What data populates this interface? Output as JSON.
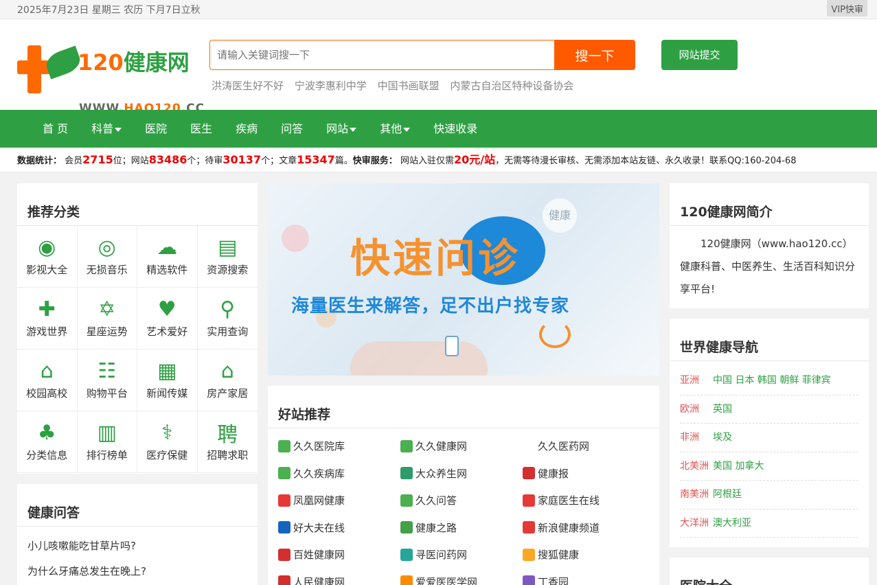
{
  "topbar": {
    "date": "2025年7月23日 星期三 农历 下月7日立秋",
    "vip": "VIP快审"
  },
  "logo": {
    "title_num": "120",
    "title_text": "健康网",
    "url_a": "WWW.",
    "url_b": "HAO120",
    "url_c": ".CC"
  },
  "search": {
    "placeholder": "请输入关键词搜一下",
    "button": "搜一下"
  },
  "submit": "网站提交",
  "hotlinks": [
    "洪涛医生好不好",
    "宁波李惠利中学",
    "中国书画联盟",
    "内蒙古自治区特种设备协会"
  ],
  "nav": [
    {
      "label": "首 页",
      "dropdown": false
    },
    {
      "label": "科普",
      "dropdown": true
    },
    {
      "label": "医院",
      "dropdown": false
    },
    {
      "label": "医生",
      "dropdown": false
    },
    {
      "label": "疾病",
      "dropdown": false
    },
    {
      "label": "问答",
      "dropdown": false
    },
    {
      "label": "网站",
      "dropdown": true
    },
    {
      "label": "其他",
      "dropdown": true
    },
    {
      "label": "快速收录",
      "dropdown": false
    }
  ],
  "stats": {
    "label": "数据统计：",
    "members_pre": "会员",
    "members": "2715",
    "members_suf": "位；网站",
    "sites": "83486",
    "sites_suf": "个；待审",
    "pending": "30137",
    "pending_suf": "个；文章",
    "articles": "15347",
    "articles_suf": "篇。",
    "service_label": "快审服务：",
    "service_pre": "网站入驻仅需",
    "price": "20元/站",
    "service_suf": "，无需等待漫长审核、无需添加本站友链、永久收录！联系QQ:160-204-68"
  },
  "categories": {
    "title": "推荐分类",
    "items": [
      {
        "label": "影视大全",
        "icon": "film-reel-icon"
      },
      {
        "label": "无损音乐",
        "icon": "music-disc-icon"
      },
      {
        "label": "精选软件",
        "icon": "cloud-download-icon"
      },
      {
        "label": "资源搜索",
        "icon": "file-search-icon"
      },
      {
        "label": "游戏世界",
        "icon": "gamepad-icon"
      },
      {
        "label": "星座运势",
        "icon": "star-of-david-icon"
      },
      {
        "label": "艺术爱好",
        "icon": "heart-badge-icon"
      },
      {
        "label": "实用查询",
        "icon": "hand-search-icon"
      },
      {
        "label": "校园高校",
        "icon": "building-columns-icon"
      },
      {
        "label": "购物平台",
        "icon": "shopping-bag-icon"
      },
      {
        "label": "新闻传媒",
        "icon": "newspaper-icon"
      },
      {
        "label": "房产家居",
        "icon": "house-icon"
      },
      {
        "label": "分类信息",
        "icon": "clover-icon"
      },
      {
        "label": "排行榜单",
        "icon": "podium-icon"
      },
      {
        "label": "医疗保健",
        "icon": "caduceus-icon"
      },
      {
        "label": "招聘求职",
        "icon": "recruit-icon"
      }
    ]
  },
  "qa": {
    "title": "健康问答",
    "items": [
      "小儿咳嗽能吃甘草片吗?",
      "为什么牙痛总发生在晚上?"
    ]
  },
  "banner": {
    "headline": "快速问诊",
    "tagline": "海量医生来解答，足不出户找专家",
    "badge": "健康"
  },
  "sites": {
    "title": "好站推荐",
    "items": [
      {
        "label": "久久医院库",
        "color": "#4caf50"
      },
      {
        "label": "久久健康网",
        "color": "#4caf50"
      },
      {
        "label": "久久医药网",
        "color": "#ffffff"
      },
      {
        "label": "久久疾病库",
        "color": "#4caf50"
      },
      {
        "label": "大众养生网",
        "color": "#2e9b6a"
      },
      {
        "label": "健康报",
        "color": "#d32f2f"
      },
      {
        "label": "凤凰网健康",
        "color": "#e53935"
      },
      {
        "label": "久久问答",
        "color": "#4caf50"
      },
      {
        "label": "家庭医生在线",
        "color": "#e53935"
      },
      {
        "label": "好大夫在线",
        "color": "#1565c0"
      },
      {
        "label": "健康之路",
        "color": "#43a047"
      },
      {
        "label": "新浪健康频道",
        "color": "#e53935"
      },
      {
        "label": "百姓健康网",
        "color": "#d32f2f"
      },
      {
        "label": "寻医问药网",
        "color": "#26a69a"
      },
      {
        "label": "搜狐健康",
        "color": "#f9a825"
      },
      {
        "label": "人民健康网",
        "color": "#d32f2f"
      },
      {
        "label": "爱爱医医学网",
        "color": "#fb8c00"
      },
      {
        "label": "丁香园",
        "color": "#7e57c2"
      }
    ]
  },
  "intro": {
    "title": "120健康网简介",
    "text": "120健康网（www.hao120.cc）健康科普、中医养生、生活百科知识分享平台!"
  },
  "world": {
    "title": "世界健康导航",
    "rows": [
      {
        "region": "亚洲",
        "countries": "中国 日本 韩国 朝鲜 菲律宾"
      },
      {
        "region": "欧洲",
        "countries": "英国"
      },
      {
        "region": "非洲",
        "countries": "埃及"
      },
      {
        "region": "北美洲",
        "countries": "美国 加拿大"
      },
      {
        "region": "南美洲",
        "countries": "阿根廷"
      },
      {
        "region": "大洋洲",
        "countries": "澳大利亚"
      }
    ]
  },
  "hospital": {
    "title": "医院大全"
  },
  "colors": {
    "green": "#2ea043",
    "orange": "#ff6a00",
    "red": "#e00000"
  }
}
